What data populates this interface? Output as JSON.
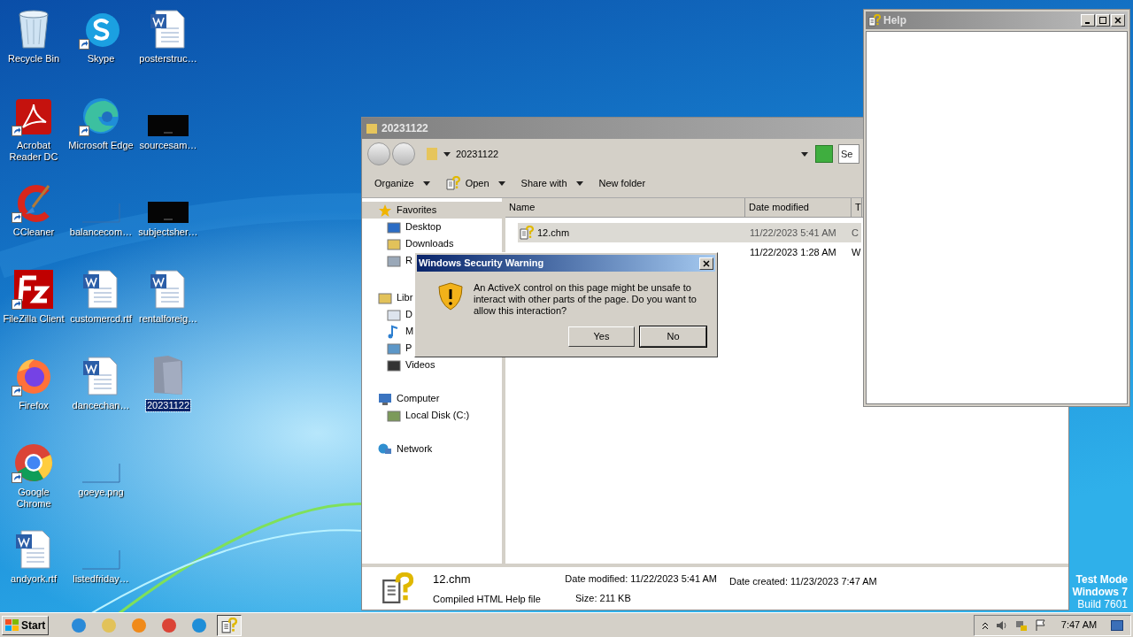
{
  "desktop_columns": [
    [
      {
        "label": "Recycle Bin",
        "kind": "bin",
        "shortcut": false,
        "selected": false
      },
      {
        "label": "Acrobat Reader DC",
        "kind": "acrobat",
        "shortcut": true,
        "selected": false
      },
      {
        "label": "CCleaner",
        "kind": "ccleaner",
        "shortcut": true,
        "selected": false
      },
      {
        "label": "FileZilla Client",
        "kind": "filezilla",
        "shortcut": true,
        "selected": false
      },
      {
        "label": "Firefox",
        "kind": "firefox",
        "shortcut": true,
        "selected": false
      },
      {
        "label": "Google Chrome",
        "kind": "chrome",
        "shortcut": true,
        "selected": false
      },
      {
        "label": "andyork.rtf",
        "kind": "doc",
        "shortcut": false,
        "selected": false
      }
    ],
    [
      {
        "label": "Skype",
        "kind": "skype",
        "shortcut": true,
        "selected": false
      },
      {
        "label": "Microsoft Edge",
        "kind": "edge",
        "shortcut": true,
        "selected": false
      },
      {
        "label": "balancecom…",
        "kind": "blank",
        "shortcut": false,
        "selected": false
      },
      {
        "label": "customercd.rtf",
        "kind": "doc",
        "shortcut": false,
        "selected": false
      },
      {
        "label": "dancechan…",
        "kind": "doc",
        "shortcut": false,
        "selected": false
      },
      {
        "label": "goeye.png",
        "kind": "blank",
        "shortcut": false,
        "selected": false
      },
      {
        "label": "listedfriday…",
        "kind": "blank",
        "shortcut": false,
        "selected": false
      }
    ],
    [
      {
        "label": "posterstruc…",
        "kind": "doc",
        "shortcut": false,
        "selected": false
      },
      {
        "label": "sourcesam…",
        "kind": "dark",
        "shortcut": false,
        "selected": false
      },
      {
        "label": "subjectsher…",
        "kind": "dark",
        "shortcut": false,
        "selected": false
      },
      {
        "label": "rentalforeig…",
        "kind": "doc",
        "shortcut": false,
        "selected": false
      },
      {
        "label": "20231122",
        "kind": "folder",
        "shortcut": false,
        "selected": true
      }
    ]
  ],
  "explorer": {
    "title": "20231122",
    "address": "20231122",
    "search_placeholder": "Se",
    "toolbar": [
      {
        "label": "Organize",
        "kind": "text",
        "dropdown": true
      },
      {
        "label": "Open",
        "kind": "chm",
        "dropdown": true
      },
      {
        "label": "Share with",
        "kind": "text",
        "dropdown": true
      },
      {
        "label": "New folder",
        "kind": "text",
        "dropdown": false
      }
    ],
    "nav": [
      {
        "label": "Favorites",
        "kind": "star",
        "selected": true,
        "children": [
          {
            "label": "Desktop",
            "kind": "desktop",
            "selected": false
          },
          {
            "label": "Downloads",
            "kind": "downloads",
            "selected": false
          },
          {
            "label": "R",
            "kind": "recent",
            "selected": false
          }
        ]
      },
      {
        "label": "Libr",
        "kind": "library",
        "selected": false,
        "children": [
          {
            "label": "D",
            "kind": "documents",
            "selected": false
          },
          {
            "label": "M",
            "kind": "music",
            "selected": false
          },
          {
            "label": "P",
            "kind": "pictures",
            "selected": false
          },
          {
            "label": "Videos",
            "kind": "videos",
            "selected": false
          }
        ]
      },
      {
        "label": "Computer",
        "kind": "computer",
        "selected": false,
        "children": [
          {
            "label": "Local Disk (C:)",
            "kind": "disk",
            "selected": false
          }
        ]
      },
      {
        "label": "Network",
        "kind": "network",
        "selected": false
      }
    ],
    "columns": [
      "Name",
      "Date modified",
      "T"
    ],
    "rows": [
      {
        "name": "12.chm",
        "date": "11/22/2023 5:41 AM",
        "type": "C",
        "selected": true
      },
      {
        "date": "11/22/2023 1:28 AM",
        "type": "W",
        "selected": false
      }
    ],
    "details": {
      "name": "12.chm",
      "type": "Compiled HTML Help file",
      "modified_label": "Date modified:",
      "modified": "11/22/2023 5:41 AM",
      "size_label": "Size:",
      "size": "211 KB",
      "created_label": "Date created:",
      "created": "11/23/2023 7:47 AM"
    }
  },
  "help_window": {
    "title": "Help"
  },
  "dialog": {
    "title": "Windows Security Warning",
    "message": "An ActiveX control on this page might be unsafe to interact with other parts of the page. Do you want to allow this interaction?",
    "buttons": [
      {
        "label": "Yes",
        "default": false
      },
      {
        "label": "No",
        "default": true
      }
    ]
  },
  "taskbar": {
    "start": "Start",
    "apps": [
      {
        "kind": "ie",
        "active": false
      },
      {
        "kind": "explorer",
        "active": false
      },
      {
        "kind": "media",
        "active": false
      },
      {
        "kind": "chrome",
        "active": false
      },
      {
        "kind": "edge",
        "active": false
      },
      {
        "kind": "chm",
        "active": true
      }
    ],
    "clock": "7:47 AM"
  },
  "watermark": [
    "Test Mode",
    "Windows 7",
    "Build 7601"
  ]
}
